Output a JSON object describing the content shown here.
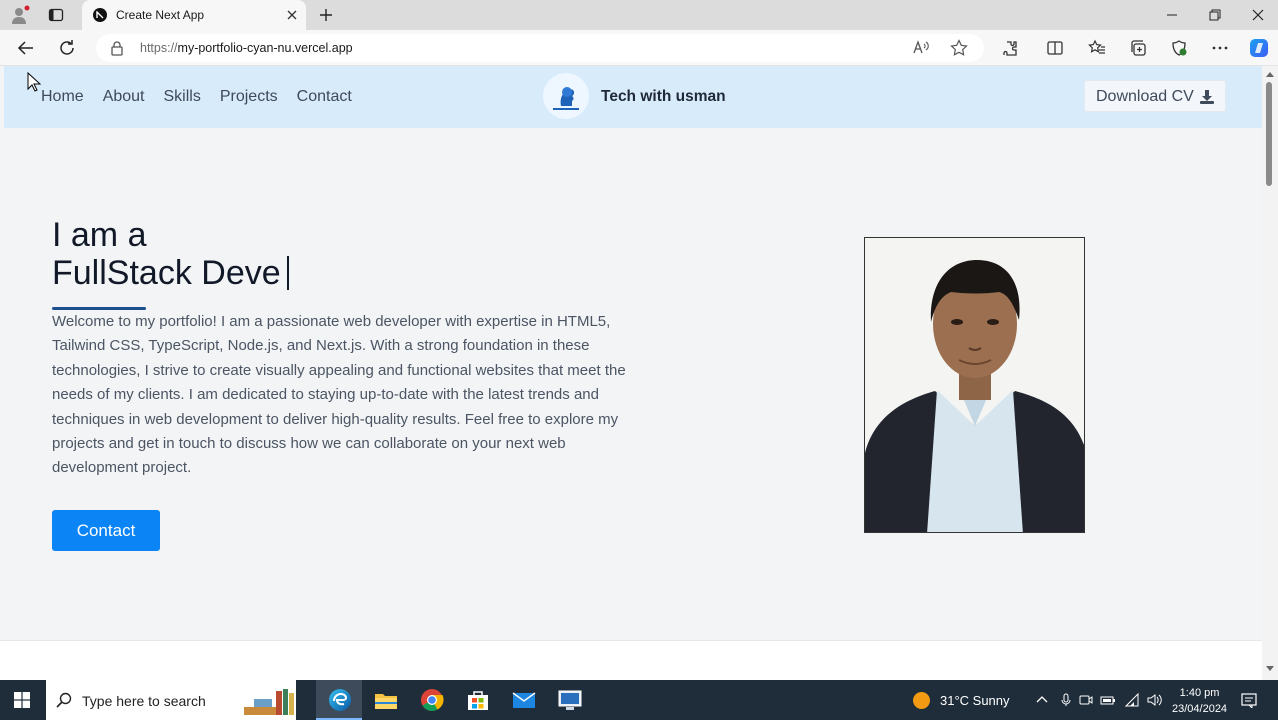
{
  "browser": {
    "tab_title": "Create Next App",
    "url_protocol": "https://",
    "url_host": "my-portfolio-cyan-nu.vercel.app"
  },
  "site": {
    "nav": [
      "Home",
      "About",
      "Skills",
      "Projects",
      "Contact"
    ],
    "brand_name": "Tech with usman",
    "download_label": "Download CV"
  },
  "hero": {
    "line1": "I am a",
    "line2": "FullStack Deve",
    "intro": "Welcome to my portfolio! I am a passionate web developer with expertise in HTML5, Tailwind CSS, TypeScript, Node.js, and Next.js. With a strong foundation in these technologies, I strive to create visually appealing and functional websites that meet the needs of my clients. I am dedicated to staying up-to-date with the latest trends and techniques in web development to deliver high-quality results. Feel free to explore my projects and get in touch to discuss how we can collaborate on your next web development project.",
    "contact_label": "Contact"
  },
  "taskbar": {
    "search_placeholder": "Type here to search",
    "weather": "31°C  Sunny",
    "time": "1:40 pm",
    "date": "23/04/2024"
  },
  "icons": {
    "browser": [
      "profile-icon",
      "tab-actions-icon",
      "close-icon",
      "new-tab-icon",
      "back-icon",
      "refresh-icon",
      "lock-icon",
      "read-aloud-icon",
      "favorite-icon",
      "extensions-icon",
      "split-screen-icon",
      "favorites-icon",
      "collections-icon",
      "browser-essentials-icon",
      "more-icon",
      "copilot-icon"
    ],
    "taskbar": [
      "windows-start-icon",
      "search-icon",
      "edge-icon",
      "file-explorer-icon",
      "chrome-icon",
      "store-icon",
      "mail-icon",
      "remote-desktop-icon",
      "notifications-icon"
    ]
  },
  "colors": {
    "header_bg": "#d8ebfa",
    "page_bg": "#f3f4f6",
    "contact_button": "#0b84f5",
    "accent_line": "#1d4f8f",
    "taskbar_bg": "#1f2d3b"
  }
}
